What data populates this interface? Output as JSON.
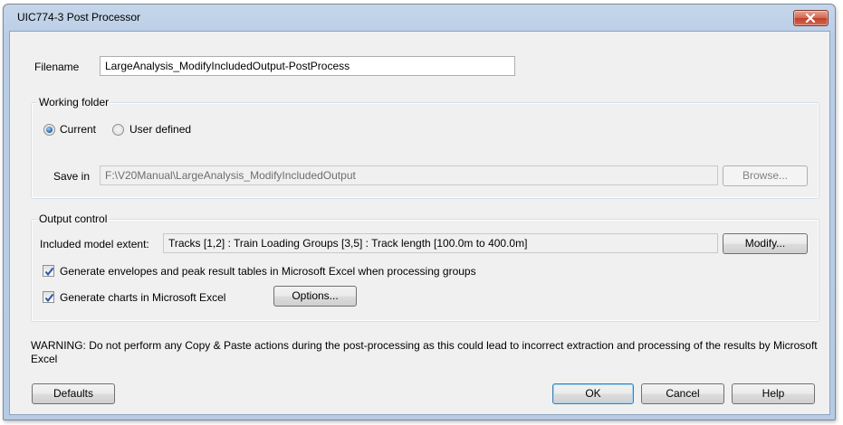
{
  "window": {
    "title": "UIC774-3 Post Processor"
  },
  "filename": {
    "label": "Filename",
    "value": "LargeAnalysis_ModifyIncludedOutput-PostProcess"
  },
  "working_folder": {
    "title": "Working folder",
    "radio_current": "Current",
    "radio_user_defined": "User defined",
    "selected": "Current",
    "save_in_label": "Save in",
    "save_in_value": "F:\\V20Manual\\LargeAnalysis_ModifyIncludedOutput",
    "browse_label": "Browse..."
  },
  "output_control": {
    "title": "Output control",
    "extent_label": "Included model extent:",
    "extent_value": "Tracks [1,2] : Train Loading Groups [3,5] : Track length [100.0m to 400.0m]",
    "modify_label": "Modify...",
    "generate_envelopes_label": "Generate envelopes and peak result tables in Microsoft Excel when processing groups",
    "generate_envelopes_checked": true,
    "generate_charts_label": "Generate charts in Microsoft Excel",
    "generate_charts_checked": true,
    "options_label": "Options..."
  },
  "warning": "WARNING: Do not perform any Copy & Paste actions during the post-processing as this could lead to incorrect extraction and processing of the results by Microsoft Excel",
  "buttons": {
    "defaults": "Defaults",
    "ok": "OK",
    "cancel": "Cancel",
    "help": "Help"
  },
  "icons": {
    "close": "close-icon",
    "checkmark": "checkmark-icon"
  }
}
